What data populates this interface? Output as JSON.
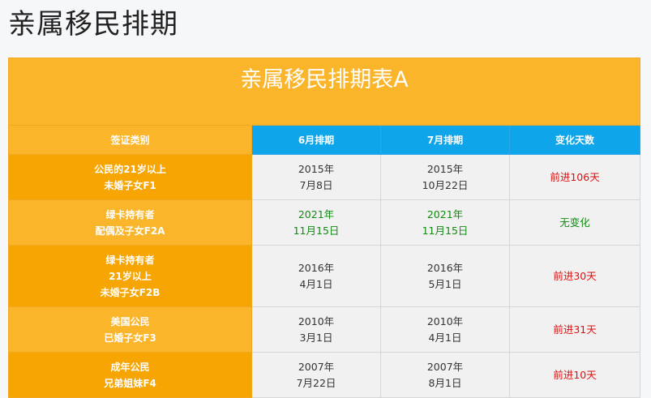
{
  "page": {
    "title": "亲属移民排期"
  },
  "table": {
    "caption": "亲属移民排期表A",
    "headers": {
      "category": "签证类别",
      "june": "6月排期",
      "july": "7月排期",
      "change": "变化天数"
    },
    "rows": [
      {
        "category": [
          "公民的21岁以上",
          "未婚子女F1"
        ],
        "june": [
          "2015年",
          "7月8日"
        ],
        "july": [
          "2015年",
          "10月22日"
        ],
        "change": "前进106天",
        "status": "advanced",
        "status_color": "#dd1111"
      },
      {
        "category": [
          "绿卡持有者",
          "配偶及子女F2A"
        ],
        "june": [
          "2021年",
          "11月15日"
        ],
        "july": [
          "2021年",
          "11月15日"
        ],
        "change": "无变化",
        "status": "unchanged",
        "status_color": "#128a12"
      },
      {
        "category": [
          "绿卡持有者",
          "21岁以上",
          "未婚子女F2B"
        ],
        "june": [
          "2016年",
          "4月1日"
        ],
        "july": [
          "2016年",
          "5月1日"
        ],
        "change": "前进30天",
        "status": "advanced",
        "status_color": "#dd1111"
      },
      {
        "category": [
          "美国公民",
          "已婚子女F3"
        ],
        "june": [
          "2010年",
          "3月1日"
        ],
        "july": [
          "2010年",
          "4月1日"
        ],
        "change": "前进31天",
        "status": "advanced",
        "status_color": "#dd1111"
      },
      {
        "category": [
          "成年公民",
          "兄弟姐妹F4"
        ],
        "june": [
          "2007年",
          "7月22日"
        ],
        "july": [
          "2007年",
          "8月1日"
        ],
        "change": "前进10天",
        "status": "advanced",
        "status_color": "#dd1111"
      }
    ]
  },
  "colors": {
    "header_orange": "#fab52a",
    "category_orange": "#f6a503",
    "header_blue": "#0ea5ea",
    "cell_bg": "#f1f1f1",
    "advance_red": "#dd1111",
    "unchanged_green": "#128a12"
  }
}
